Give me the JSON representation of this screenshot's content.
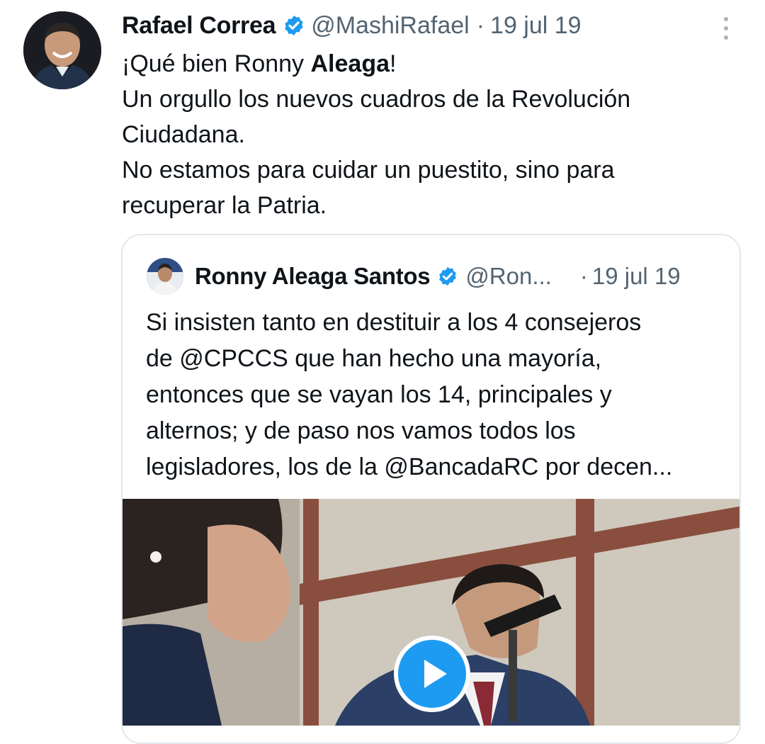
{
  "tweet": {
    "author_name": "Rafael Correa",
    "handle": "@MashiRafael",
    "separator": "·",
    "date": "19 jul 19",
    "text_line1_a": "¡Qué bien Ronny ",
    "text_line1_b": "Aleaga",
    "text_line1_c": "!",
    "text_line2": "Un orgullo los nuevos cuadros de la Revolución",
    "text_line3": "Ciudadana.",
    "text_line4": "No estamos para cuidar un puestito, sino para",
    "text_line5": "recuperar la Patria."
  },
  "quoted_tweet": {
    "author_name": "Ronny Aleaga Santos",
    "handle": "@Ron...",
    "separator": "·",
    "date": "19 jul 19",
    "lines": [
      "Si insisten tanto en destituir a los 4 consejeros",
      "de @CPCCS que han hecho una mayoría,",
      "entonces que se vayan los 14, principales y",
      "alternos; y de paso nos vamos todos los",
      "legisladores, los de la @BancadaRC por decen..."
    ]
  },
  "icons": {
    "verified": "verified-badge-icon",
    "more": "more-vertical-icon",
    "play": "play-icon"
  },
  "colors": {
    "verified_blue": "#1d9bf0",
    "secondary_text": "#536471",
    "primary_text": "#0f1419",
    "border": "#e1e8ed"
  }
}
